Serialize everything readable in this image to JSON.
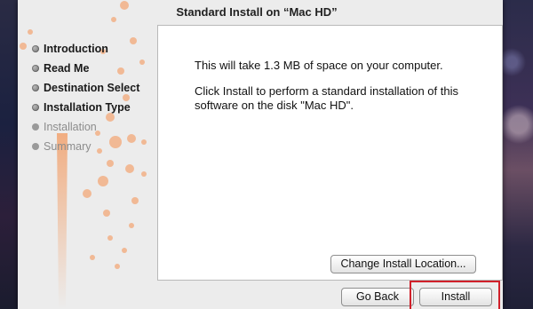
{
  "window": {
    "title": "Standard Install on “Mac HD”"
  },
  "sidebar": {
    "steps": [
      {
        "label": "Introduction",
        "state": "done"
      },
      {
        "label": "Read Me",
        "state": "done"
      },
      {
        "label": "Destination Select",
        "state": "done"
      },
      {
        "label": "Installation Type",
        "state": "current"
      },
      {
        "label": "Installation",
        "state": "pending"
      },
      {
        "label": "Summary",
        "state": "pending"
      }
    ]
  },
  "content": {
    "space_message": "This will take 1.3 MB of space on your computer.",
    "install_message": "Click Install to perform a standard installation of this software on the disk \"Mac HD\"."
  },
  "buttons": {
    "change_location": "Change Install Location...",
    "go_back": "Go Back",
    "install": "Install"
  },
  "colors": {
    "highlight": "#d0202a",
    "art_orange": "#f0a070"
  }
}
